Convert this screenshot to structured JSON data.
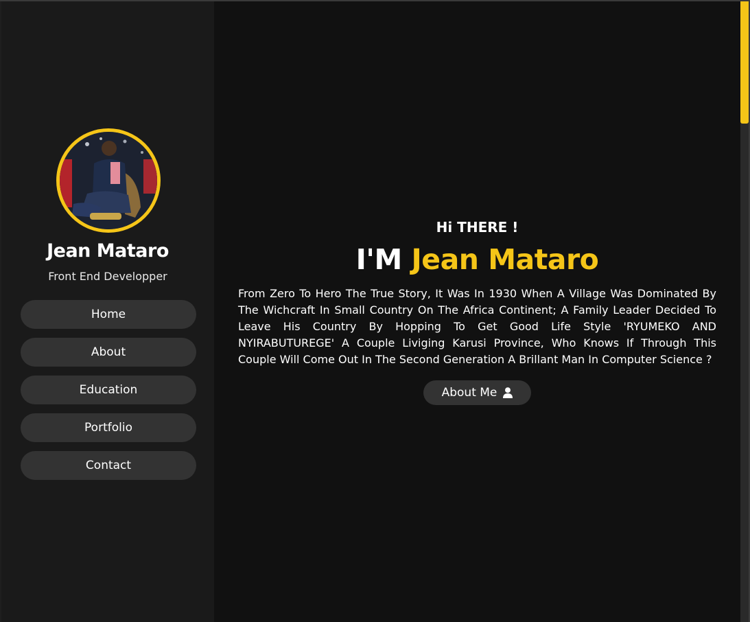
{
  "profile": {
    "name": "Jean Mataro",
    "role": "Front End Developper"
  },
  "nav": {
    "items": [
      {
        "label": "Home"
      },
      {
        "label": "About"
      },
      {
        "label": "Education"
      },
      {
        "label": "Portfolio"
      },
      {
        "label": "Contact"
      }
    ]
  },
  "hero": {
    "greeting": "Hi THERE !",
    "prefix": "I'M",
    "highlight": "Jean Mataro",
    "paragraph": "From Zero To Hero The True Story, It Was In 1930 When A Village Was Dominated By The Wichcraft In Small Country On The Africa Continent; A Family Leader Decided To Leave His Country By Hopping To Get Good Life Style 'RYUMEKO AND NYIRABUTUREGE' A Couple Liviging Karusi Province, Who Knows If Through This Couple Will Come Out In The Second Generation A Brillant Man In Computer Science ?",
    "button_label": "About Me",
    "button_icon": "user-icon"
  },
  "colors": {
    "accent": "#f5c518",
    "sidebar_bg": "#1a1a1a",
    "main_bg": "#111111",
    "button_bg": "#333333"
  }
}
